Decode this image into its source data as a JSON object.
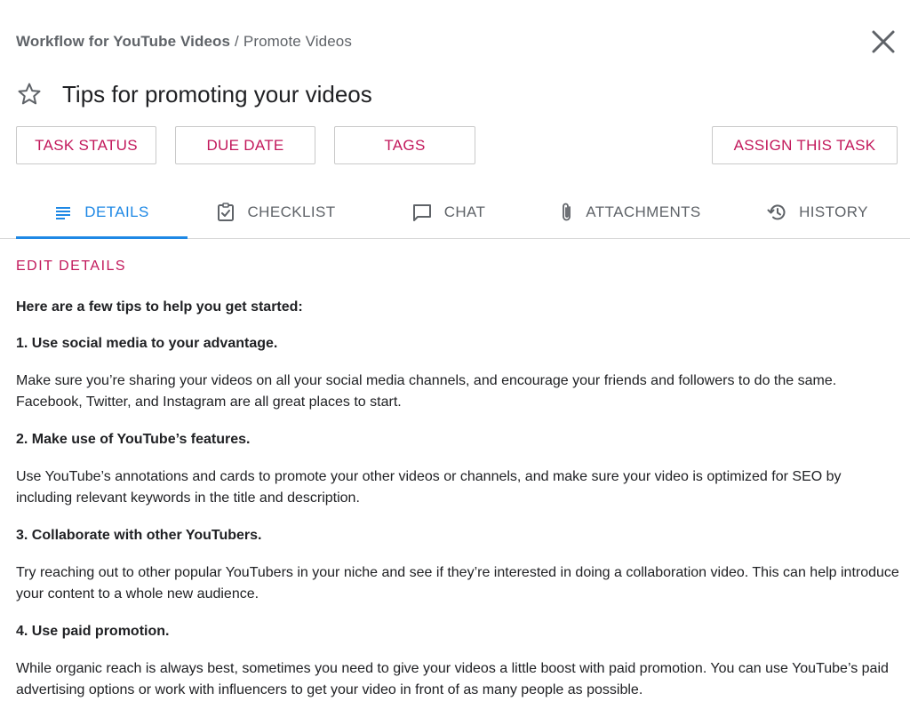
{
  "breadcrumb": {
    "parent": "Workflow for YouTube Videos",
    "separator": "/",
    "current": "Promote Videos"
  },
  "icons": {
    "close": "close-icon",
    "star": "star-outline-icon",
    "details": "lines-icon",
    "checklist": "clipboard-check-icon",
    "chat": "chat-bubble-icon",
    "attachments": "paperclip-icon",
    "history": "history-icon"
  },
  "title": "Tips for promoting your videos",
  "actions": {
    "task_status": "TASK STATUS",
    "due_date": "DUE DATE",
    "tags": "TAGS",
    "assign": "ASSIGN THIS TASK"
  },
  "tabs": [
    {
      "label": "DETAILS",
      "active": true
    },
    {
      "label": "CHECKLIST",
      "active": false
    },
    {
      "label": "CHAT",
      "active": false
    },
    {
      "label": "ATTACHMENTS",
      "active": false
    },
    {
      "label": "HISTORY",
      "active": false
    }
  ],
  "edit_details": "EDIT DETAILS",
  "content": {
    "intro": "Here are a few tips to help you get started:",
    "tips": [
      {
        "heading": "1. Use social media to your advantage.",
        "body": "Make sure you’re sharing your videos on all your social media channels, and encourage your friends and followers to do the same. Facebook, Twitter, and Instagram are all great places to start."
      },
      {
        "heading": "2. Make use of YouTube’s features.",
        "body": "Use YouTube’s annotations and cards to promote your other videos or channels, and make sure your video is optimized for SEO by including relevant keywords in the title and description."
      },
      {
        "heading": "3. Collaborate with other YouTubers.",
        "body": "Try reaching out to other popular YouTubers in your niche and see if they’re interested in doing a collaboration video. This can help introduce your content to a whole new audience."
      },
      {
        "heading": "4. Use paid promotion.",
        "body": "While organic reach is always best, sometimes you need to give your videos a little boost with paid promotion. You can use YouTube’s paid advertising options or work with influencers to get your video in front of as many people as possible."
      }
    ]
  },
  "colors": {
    "accent": "#c2185b",
    "active_tab": "#1e88e5",
    "text": "#202124",
    "muted": "#5f6368"
  }
}
